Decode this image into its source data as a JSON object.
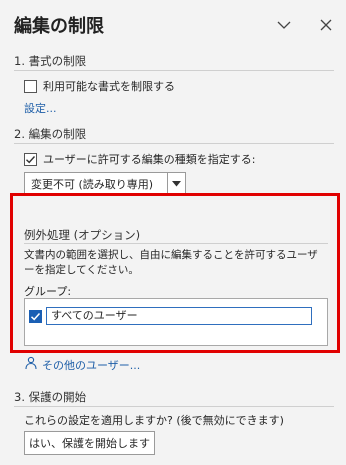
{
  "panel": {
    "title": "編集の制限"
  },
  "section1": {
    "title": "1. 書式の制限",
    "checkbox_label": "利用可能な書式を制限する",
    "checkbox_checked": false,
    "settings_link": "設定..."
  },
  "section2": {
    "title": "2. 編集の制限",
    "checkbox_label": "ユーザーに許可する編集の種類を指定する:",
    "checkbox_checked": true,
    "select_value": "変更不可 (読み取り専用)"
  },
  "exceptions": {
    "title": "例外処理 (オプション)",
    "description": "文書内の範囲を選択し、自由に編集することを許可するユーザーを指定してください。",
    "group_label": "グループ:",
    "groups": [
      {
        "name": "すべてのユーザー",
        "checked": true
      }
    ],
    "more_users_link": "その他のユーザー..."
  },
  "section3": {
    "title": "3. 保護の開始",
    "question": "これらの設定を適用しますか? (後で無効にできます)",
    "start_button": "はい、保護を開始します"
  },
  "colors": {
    "highlight_border": "#e00000",
    "link": "#1f5fa8",
    "checkbox_checked": "#1a5fb4"
  },
  "icons": {
    "dropdown": "chevron-down-icon",
    "close": "close-icon",
    "users": "add-users-icon"
  }
}
